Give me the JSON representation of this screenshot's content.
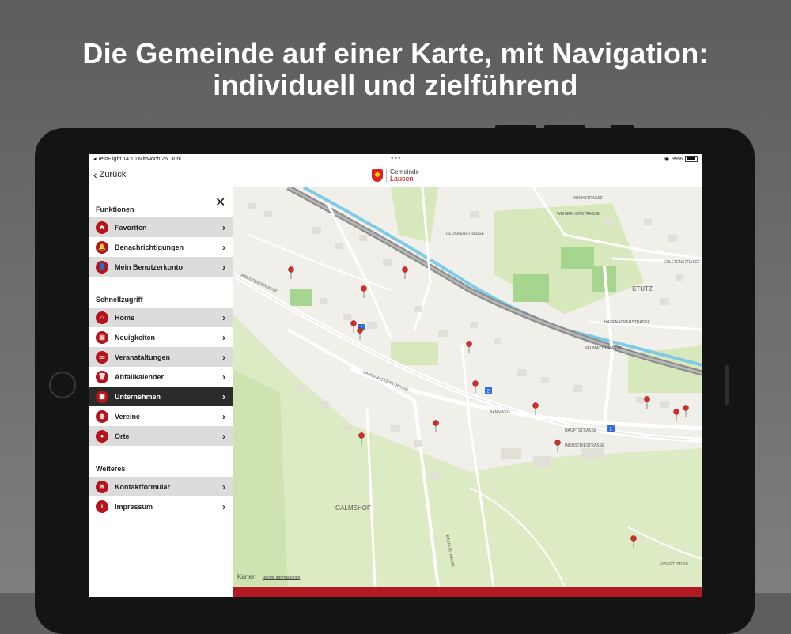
{
  "headline": {
    "line1": "Die Gemeinde auf einer Karte, mit Navigation:",
    "line2": "individuell und zielführend"
  },
  "statusbar": {
    "left": "◂ TestFlight  14:10  Mittwoch 26. Juni",
    "center": "•••",
    "battery": "99%"
  },
  "navbar": {
    "back_label": "Zurück",
    "logo_line1": "Gemeinde",
    "logo_line2": "Lausen"
  },
  "menu": {
    "close_icon": "close-icon",
    "sections": [
      {
        "title": "Funktionen"
      },
      {
        "title": "Schnellzugriff"
      },
      {
        "title": "Weiteres"
      }
    ],
    "items": [
      {
        "label": "Favoriten",
        "icon": "★"
      },
      {
        "label": "Benachrichtigungen",
        "icon": "🔔"
      },
      {
        "label": "Mein Benutzerkonto",
        "icon": "👤"
      },
      {
        "label": "Home",
        "icon": "⌂"
      },
      {
        "label": "Neuigkeiten",
        "icon": "▤"
      },
      {
        "label": "Veranstaltungen",
        "icon": "▭"
      },
      {
        "label": "Abfallkalender",
        "icon": "🗑"
      },
      {
        "label": "Unternehmen",
        "icon": "▦"
      },
      {
        "label": "Vereine",
        "icon": "◍"
      },
      {
        "label": "Orte",
        "icon": "●"
      },
      {
        "label": "Kontaktformular",
        "icon": "✉"
      },
      {
        "label": "Impressum",
        "icon": "i"
      }
    ],
    "arrow": "›"
  },
  "map": {
    "places": [
      "STUTZ",
      "GALMSHOF"
    ],
    "streets": [
      "INDUSTRIESTRASSE",
      "HAUPTSTRASSE",
      "NEUMATTSTRASSE",
      "HASENACKERSTRASSE",
      "EDLETENSTRASSE",
      "WEIHERHOFSTRASSE",
      "GLOCKENSTRASSE",
      "BANNWEG",
      "LANGENACKERSTRASSE",
      "VIAGOTTARDO",
      "BÄCHLISTRASSE",
      "HOCHSTRASSE"
    ],
    "route_badges": [
      "2",
      "2",
      "2"
    ],
    "credit": "Karten",
    "credit_link": "Rechtl. Informationen"
  }
}
